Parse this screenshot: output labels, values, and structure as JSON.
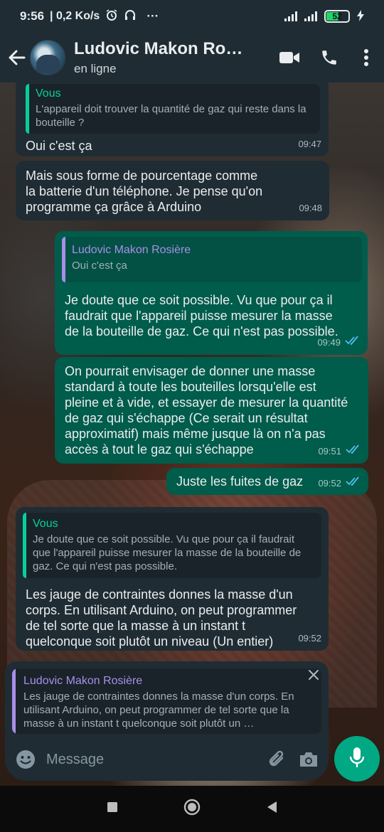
{
  "status_bar": {
    "time": "9:56",
    "speed": "| 0,2 Ko/s",
    "more": "···",
    "battery": "52"
  },
  "header": {
    "contact_name": "Ludovic Makon Rosière",
    "contact_status": "en ligne"
  },
  "messages": [
    {
      "direction": "in",
      "quote_name": "Vous",
      "quote_text": "L'appareil doit trouver la quantité de gaz qui reste dans la bouteille ?",
      "text": "Oui c'est ça",
      "time": "09:47"
    },
    {
      "direction": "in",
      "text": "Mais sous forme de pourcentage comme\nla batterie d'un téléphone. Je pense qu'on\nprogramme ça grâce à Arduino",
      "time": "09:48"
    },
    {
      "direction": "out",
      "quote_name": "Ludovic Makon Rosière",
      "quote_text": "Oui c'est ça",
      "text": "Je doute que ce soit possible. Vu que pour ça il\nfaudrait que l'appareil puisse mesurer la masse\nde la bouteille de gaz. Ce qui n'est pas possible.",
      "time": "09:49",
      "read": true
    },
    {
      "direction": "out",
      "text": "On pourrait envisager de donner une masse\nstandard à toute les bouteilles lorsqu'elle est\npleine et à vide, et essayer de mesurer la quantité\nde gaz qui s'échappe (Ce serait un résultat\napproximatif) mais même jusque là on n'a pas\naccès à tout le gaz qui s'échappe",
      "time": "09:51",
      "read": true
    },
    {
      "direction": "out",
      "text": "Juste les fuites de gaz",
      "time": "09:52",
      "read": true
    },
    {
      "direction": "in",
      "quote_name": "Vous",
      "quote_text": "Je doute que ce soit possible. Vu que pour ça il faudrait que l'appareil puisse mesurer la masse de la bouteille de gaz. Ce qui n'est pas possible.",
      "text": "Les jauge de contraintes donnes la masse d'un\ncorps. En utilisant Arduino, on peut programmer\nde tel sorte que la masse à un instant t\nquelconque soit plutôt un niveau (Un entier)",
      "time": "09:52"
    }
  ],
  "reply_preview": {
    "name": "Ludovic Makon Rosière",
    "text": "Les jauge de contraintes donnes la masse d'un corps. En utilisant Arduino, on peut programmer de tel sorte que la masse à un instant t quelconque soit plutôt un …"
  },
  "composer": {
    "placeholder": "Message"
  },
  "colors": {
    "incoming": "#202c33",
    "outgoing": "#005c4b",
    "accent": "#00a884",
    "read_tick": "#53bdeb"
  },
  "icons": [
    "back-icon",
    "video-call-icon",
    "phone-icon",
    "menu-dots-icon",
    "close-icon",
    "emoji-icon",
    "attach-icon",
    "camera-icon",
    "mic-icon",
    "read-ticks-icon",
    "nav-recent-icon",
    "nav-home-icon",
    "nav-back-icon"
  ]
}
